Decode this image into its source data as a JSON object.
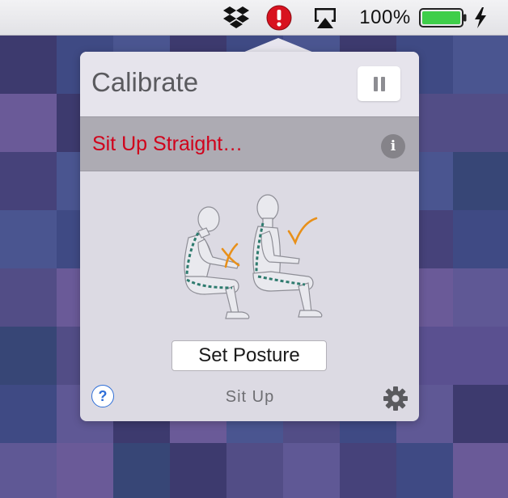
{
  "menubar": {
    "icons": [
      "dropbox-icon",
      "posture-alert-icon",
      "airplay-icon",
      "battery-icon",
      "charging-bolt-icon"
    ],
    "battery_percent": "100%",
    "battery_level": 1.0,
    "battery_color": "#3fce4a"
  },
  "popover": {
    "title": "Calibrate",
    "pause_icon": "pause-icon",
    "status_text": "Sit Up Straight…",
    "status_color": "#d0021b",
    "info_glyph": "i",
    "illustration": "slouch-vs-upright-posture",
    "set_posture_label": "Set Posture",
    "help_glyph": "?",
    "mode_label": "Sit Up",
    "settings_icon": "gear-icon",
    "accent_color": "#e8901a",
    "spine_color": "#2e7b6e"
  },
  "desktop": {
    "palette": [
      "#3d3a6e",
      "#46427a",
      "#524d86",
      "#3f4a84",
      "#5a5090",
      "#6a5a98",
      "#4a5590",
      "#374676",
      "#5f5895"
    ]
  }
}
